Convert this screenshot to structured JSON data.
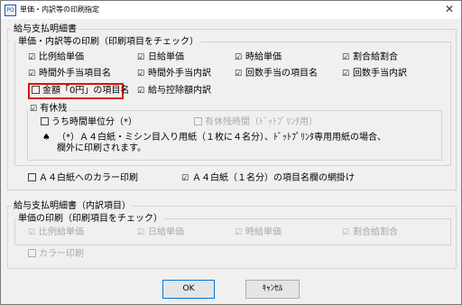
{
  "window": {
    "title": "単価・内訳等の印刷指定",
    "app_icon": "PO"
  },
  "group1": {
    "legend": "給与支払明細書",
    "sub_legend": "単価・内訳等の印刷（印刷項目をチェック）",
    "items": [
      {
        "label": "比例給単価",
        "checked": true
      },
      {
        "label": "日給単価",
        "checked": true
      },
      {
        "label": "時給単価",
        "checked": true
      },
      {
        "label": "割合給割合",
        "checked": true
      },
      {
        "label": "時間外手当項目名",
        "checked": true
      },
      {
        "label": "時間外手当内訳",
        "checked": true
      },
      {
        "label": "回数手当の項目名",
        "checked": true
      },
      {
        "label": "回数手当内訳",
        "checked": true
      },
      {
        "label": "金額「0円」の項目名",
        "checked": false
      },
      {
        "label": "給与控除額内訳",
        "checked": true
      }
    ],
    "yukyu": {
      "legend": "有休残",
      "checked": true,
      "hourly_label": "うち時間単位分（*）",
      "hourly_checked": false,
      "disabled_label": "有休残時間（ﾄﾞｯﾄﾌﾟﾘﾝﾀ用）",
      "note_mark": "♠",
      "note_line1": "（*）Ａ４白紙・ミシン目入り用紙（１枚に４名分）、ﾄﾞｯﾄﾌﾟﾘﾝﾀ専用用紙の場合、",
      "note_line2": "欄外に印刷されます。"
    },
    "color_print_label": "Ａ４白紙へのカラー印刷",
    "color_print_checked": false,
    "hatching_label": "Ａ４白紙（１名分）の項目名欄の網掛け",
    "hatching_checked": true
  },
  "group2": {
    "legend": "給与支払明細書（内訳項目）",
    "sub_legend": "単価の印刷（印刷項目をチェック）",
    "items": [
      {
        "label": "比例給単価",
        "checked": true
      },
      {
        "label": "日給単価",
        "checked": true
      },
      {
        "label": "時給単価",
        "checked": true
      },
      {
        "label": "割合給割合",
        "checked": true
      }
    ],
    "color_label": "カラー印刷"
  },
  "buttons": {
    "ok": "OK",
    "cancel": "ｷｬﾝｾﾙ"
  },
  "check_glyph": "☑"
}
